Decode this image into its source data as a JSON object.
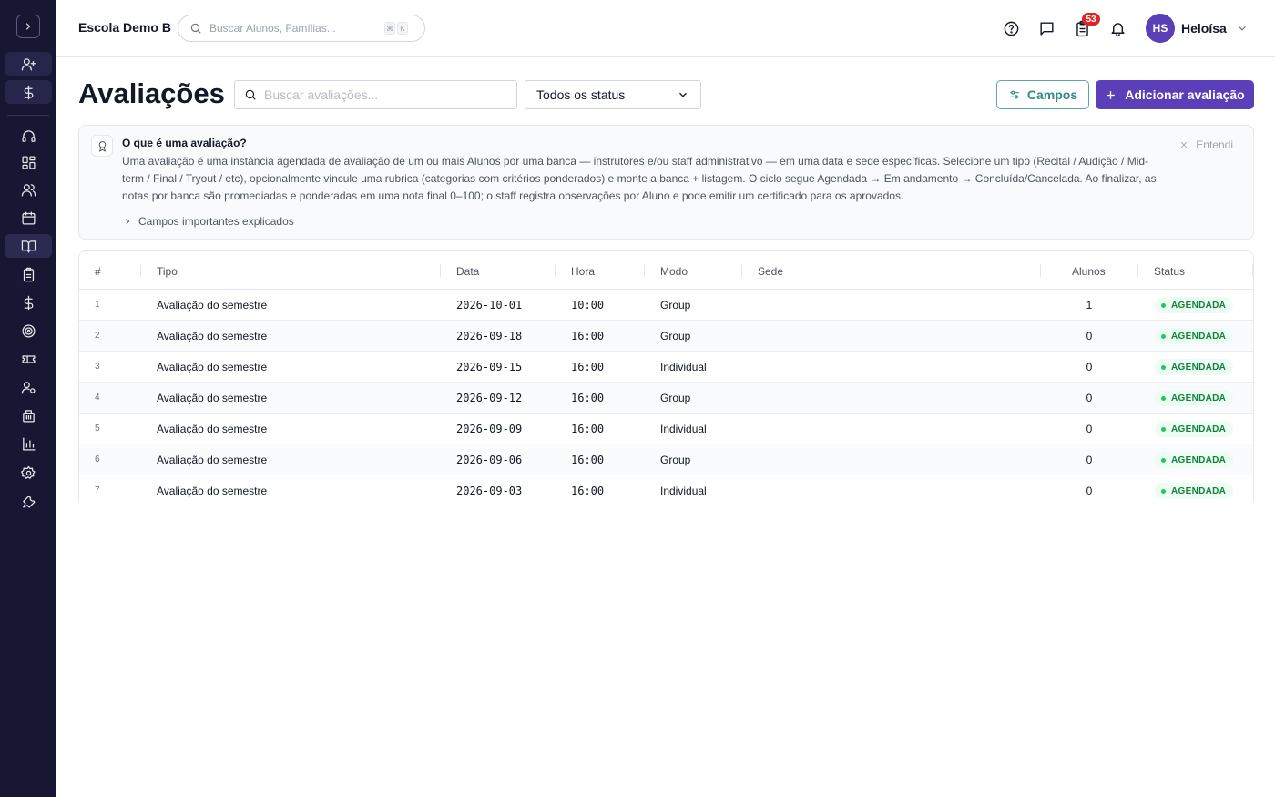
{
  "sidebar": {
    "toggle_icon": "chevron-right-icon",
    "items": [
      {
        "name": "add-user",
        "icon": "user-plus-icon"
      },
      {
        "name": "finance",
        "icon": "dollar-icon"
      },
      {
        "name": "support",
        "icon": "headset-icon"
      },
      {
        "name": "dashboard",
        "icon": "grid-icon"
      },
      {
        "name": "people",
        "icon": "users-icon"
      },
      {
        "name": "calendar",
        "icon": "calendar-icon"
      },
      {
        "name": "book",
        "icon": "book-open-icon"
      },
      {
        "name": "assessments",
        "icon": "clipboard-icon"
      },
      {
        "name": "payments",
        "icon": "dollar-icon"
      },
      {
        "name": "target",
        "icon": "target-icon"
      },
      {
        "name": "tickets",
        "icon": "ticket-icon"
      },
      {
        "name": "staff",
        "icon": "user-gear-icon"
      },
      {
        "name": "buildings",
        "icon": "building-icon"
      },
      {
        "name": "reports",
        "icon": "bar-chart-icon"
      },
      {
        "name": "settings",
        "icon": "gear-icon"
      },
      {
        "name": "tools",
        "icon": "wrench-icon"
      }
    ]
  },
  "topbar": {
    "school_name": "Escola Demo B",
    "search_placeholder": "Buscar Alunos, Famílias...",
    "kbd_1": "⌘",
    "kbd_2": "K",
    "notification_count": "53",
    "user_initials": "HS",
    "user_name": "Heloísa"
  },
  "page": {
    "title": "Avaliações",
    "search_placeholder": "Buscar avaliações...",
    "status_filter": "Todos os status",
    "campos_label": "Campos",
    "add_label": "Adicionar avaliação"
  },
  "info": {
    "title": "O que é uma avaliação?",
    "text": "Uma avaliação é uma instância agendada de avaliação de um ou mais Alunos por uma banca — instrutores e/ou staff administrativo — em uma data e sede específicas. Selecione um tipo (Recital / Audição / Mid-term / Final / Tryout / etc), opcionalmente vincule uma rubrica (categorias com critérios ponderados) e monte a banca + listagem. O ciclo segue Agendada → Em andamento → Concluída/Cancelada. Ao finalizar, as notas por banca são promediadas e ponderadas em uma nota final 0–100; o staff registra observações por Aluno e pode emitir um certificado para os aprovados.",
    "dismiss_label": "Entendi",
    "expand_label": "Campos importantes explicados"
  },
  "table": {
    "columns": {
      "num": "#",
      "tipo": "Tipo",
      "data": "Data",
      "hora": "Hora",
      "modo": "Modo",
      "sede": "Sede",
      "alunos": "Alunos",
      "status": "Status"
    },
    "rows": [
      {
        "num": "1",
        "tipo": "Avaliação do semestre",
        "data": "2026-10-01",
        "hora": "10:00",
        "modo": "Group",
        "sede": "",
        "alunos": "1",
        "status": "AGENDADA"
      },
      {
        "num": "2",
        "tipo": "Avaliação do semestre",
        "data": "2026-09-18",
        "hora": "16:00",
        "modo": "Group",
        "sede": "",
        "alunos": "0",
        "status": "AGENDADA"
      },
      {
        "num": "3",
        "tipo": "Avaliação do semestre",
        "data": "2026-09-15",
        "hora": "16:00",
        "modo": "Individual",
        "sede": "",
        "alunos": "0",
        "status": "AGENDADA"
      },
      {
        "num": "4",
        "tipo": "Avaliação do semestre",
        "data": "2026-09-12",
        "hora": "16:00",
        "modo": "Group",
        "sede": "",
        "alunos": "0",
        "status": "AGENDADA"
      },
      {
        "num": "5",
        "tipo": "Avaliação do semestre",
        "data": "2026-09-09",
        "hora": "16:00",
        "modo": "Individual",
        "sede": "",
        "alunos": "0",
        "status": "AGENDADA"
      },
      {
        "num": "6",
        "tipo": "Avaliação do semestre",
        "data": "2026-09-06",
        "hora": "16:00",
        "modo": "Group",
        "sede": "",
        "alunos": "0",
        "status": "AGENDADA"
      },
      {
        "num": "7",
        "tipo": "Avaliação do semestre",
        "data": "2026-09-03",
        "hora": "16:00",
        "modo": "Individual",
        "sede": "",
        "alunos": "0",
        "status": "AGENDADA"
      }
    ]
  },
  "colors": {
    "sidebar_bg": "#181733",
    "accent": "#5b3fb8",
    "teal": "#2f8a8a",
    "status_green": "#15803d",
    "badge_red": "#dc2626"
  }
}
